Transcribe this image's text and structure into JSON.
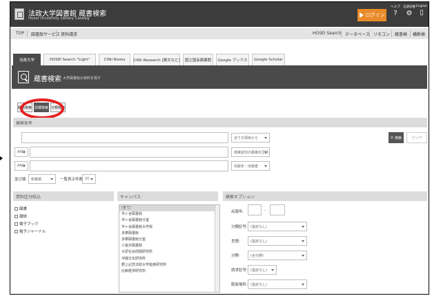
{
  "header": {
    "title": "法政大学図書館 蔵書検索",
    "subtitle": "Hosei University Library Catalog",
    "login_label": "ログイン",
    "icons": [
      {
        "name": "help-icon",
        "label": "ヘルプ",
        "glyph": "?"
      },
      {
        "name": "language-icon",
        "label": "言語切替",
        "glyph": "⚙"
      },
      {
        "name": "english-icon",
        "label": "English",
        "glyph": "▯"
      }
    ]
  },
  "menu": {
    "left": [
      "TOP",
      "図書館サービス",
      "資料請求"
    ],
    "right": [
      "HOSEI Search",
      "データベース",
      "リモコン",
      "蔵書検",
      "横断検"
    ]
  },
  "tabs": [
    "法政大学",
    "HOSEI Search \"Light\"",
    "CiNii Books",
    "CiNii Research [論文など]",
    "国立国会図書館",
    "Google ブックス",
    "Google Scholar"
  ],
  "search_head": {
    "title": "蔵書検索",
    "subtitle": "大学図書館の資料を探す"
  },
  "modes": [
    "簡易検索",
    "詳細検索",
    "分類検索"
  ],
  "conditions": {
    "section_title": "検索条件",
    "field_selects": [
      "全ての項目から",
      "検索語句の順番を区別",
      "出版年・出版者"
    ],
    "op_selects": [
      "AND",
      "AND"
    ],
    "sort_label": "並び順",
    "sort_value": "新着順",
    "count_label": "一覧表示件数",
    "count_value": "20",
    "search_button": "検索",
    "clear_button": "クリア"
  },
  "material": {
    "title": "資料区分絞込",
    "items": [
      "図書",
      "雑誌",
      "電子ブック",
      "電子ジャーナル"
    ]
  },
  "campus": {
    "title": "キャンパス",
    "items": [
      "(全て)",
      "市ヶ谷図書館",
      "市ヶ谷図書館分室",
      "市ヶ谷図書館大学院",
      "多摩図書館",
      "多摩図書館分室",
      "小金井図書館",
      "大原社会問題研究所",
      "沖縄文化研究所",
      "野上記念法政大学能楽研究所",
      "比較経済研究所"
    ]
  },
  "options": {
    "title": "検索オプション",
    "rows": [
      {
        "label": "出版年:",
        "value": "-"
      },
      {
        "label": "分類記号:",
        "value": "(指定なし)"
      },
      {
        "label": "言語:",
        "value": "(指定なし)"
      },
      {
        "label": "分野:",
        "value": "(全分野)"
      },
      {
        "label": "請求記号:",
        "value": "(指定なし)"
      },
      {
        "label": "配架場所:",
        "value": "(指定なし)"
      }
    ]
  },
  "colors": {
    "header_bg": "#3c3c3c",
    "login_orange": "#e98b2a",
    "highlight_red": "#e61e1e",
    "active_tab": "#4a4a4a"
  }
}
